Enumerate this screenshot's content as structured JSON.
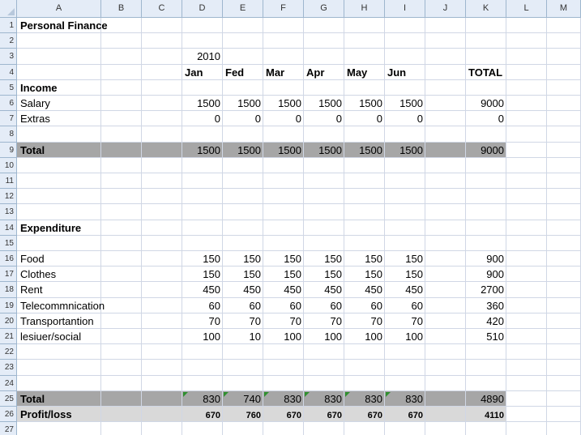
{
  "sheet": {
    "columns": [
      "A",
      "B",
      "C",
      "D",
      "E",
      "F",
      "G",
      "H",
      "I",
      "J",
      "K",
      "L",
      "M"
    ],
    "rows": [
      "1",
      "2",
      "3",
      "4",
      "5",
      "6",
      "7",
      "8",
      "9",
      "10",
      "11",
      "12",
      "13",
      "14",
      "15",
      "16",
      "17",
      "18",
      "19",
      "20",
      "21",
      "22",
      "23",
      "24",
      "25",
      "26",
      "27"
    ],
    "band_colors": {
      "dark": "#a6a6a6",
      "light": "#d9d9d9"
    },
    "cells": {
      "r1": {
        "a": "Personal Finance"
      },
      "r3": {
        "d": "2010"
      },
      "r4": {
        "d": "Jan",
        "e": "Fed",
        "f": "Mar",
        "g": "Apr",
        "h": "May",
        "i": "Jun",
        "k": "TOTAL"
      },
      "r5": {
        "a": "Income"
      },
      "r6": {
        "a": "Salary",
        "d": "1500",
        "e": "1500",
        "f": "1500",
        "g": "1500",
        "h": "1500",
        "i": "1500",
        "k": "9000"
      },
      "r7": {
        "a": "Extras",
        "d": "0",
        "e": "0",
        "f": "0",
        "g": "0",
        "h": "0",
        "i": "0",
        "k": "0"
      },
      "r9": {
        "a": "Total",
        "d": "1500",
        "e": "1500",
        "f": "1500",
        "g": "1500",
        "h": "1500",
        "i": "1500",
        "k": "9000"
      },
      "r14": {
        "a": "Expenditure"
      },
      "r16": {
        "a": "Food",
        "d": "150",
        "e": "150",
        "f": "150",
        "g": "150",
        "h": "150",
        "i": "150",
        "k": "900"
      },
      "r17": {
        "a": "Clothes",
        "d": "150",
        "e": "150",
        "f": "150",
        "g": "150",
        "h": "150",
        "i": "150",
        "k": "900"
      },
      "r18": {
        "a": "Rent",
        "d": "450",
        "e": "450",
        "f": "450",
        "g": "450",
        "h": "450",
        "i": "450",
        "k": "2700"
      },
      "r19": {
        "a": "Telecommnication",
        "d": "60",
        "e": "60",
        "f": "60",
        "g": "60",
        "h": "60",
        "i": "60",
        "k": "360"
      },
      "r20": {
        "a": "Transportantion",
        "d": "70",
        "e": "70",
        "f": "70",
        "g": "70",
        "h": "70",
        "i": "70",
        "k": "420"
      },
      "r21": {
        "a": "lesiuer/social",
        "d": "100",
        "e": "10",
        "f": "100",
        "g": "100",
        "h": "100",
        "i": "100",
        "k": "510"
      },
      "r25": {
        "a": "Total",
        "d": "830",
        "e": "740",
        "f": "830",
        "g": "830",
        "h": "830",
        "i": "830",
        "k": "4890"
      },
      "r26": {
        "a": "Profit/loss",
        "d": "670",
        "e": "760",
        "f": "670",
        "g": "670",
        "h": "670",
        "i": "670",
        "k": "4110"
      }
    }
  }
}
